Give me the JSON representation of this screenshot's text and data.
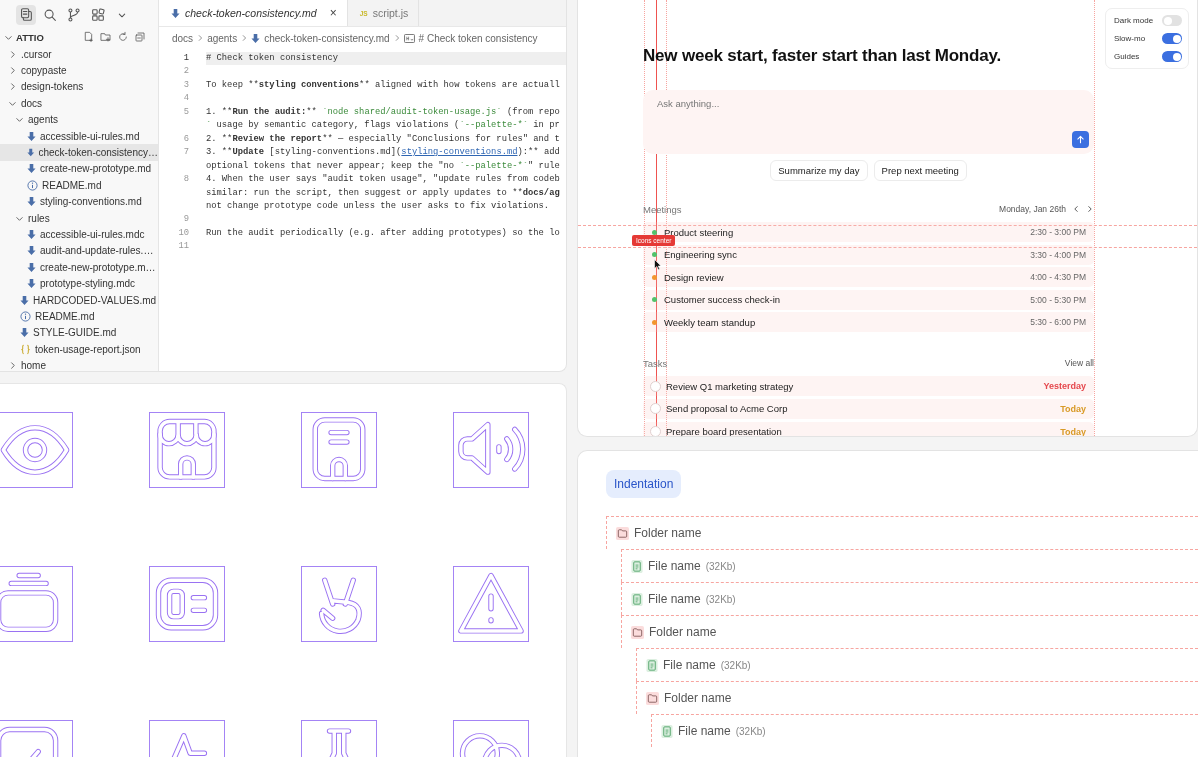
{
  "editor": {
    "activity_bar": [
      {
        "kind": "files",
        "selected": true
      },
      {
        "kind": "search",
        "selected": false
      },
      {
        "kind": "source-control",
        "selected": false
      },
      {
        "kind": "extensions",
        "selected": false
      },
      {
        "kind": "more",
        "selected": false
      }
    ],
    "explorer": {
      "title": "ATTIO",
      "expanded": true,
      "items": [
        {
          "name": ".cursor",
          "kind": "folder",
          "expanded": false,
          "selected": false
        },
        {
          "name": "copypaste",
          "kind": "folder",
          "expanded": false,
          "selected": false
        },
        {
          "name": "design-tokens",
          "kind": "folder",
          "expanded": false,
          "selected": false
        },
        {
          "name": "docs",
          "kind": "folder",
          "expanded": true,
          "selected": false,
          "children": [
            {
              "name": "agents",
              "kind": "folder",
              "expanded": true,
              "selected": false,
              "children": [
                {
                  "name": "accessible-ui-rules.md",
                  "kind": "md",
                  "selected": false
                },
                {
                  "name": "check-token-consistency…",
                  "kind": "md",
                  "selected": true
                },
                {
                  "name": "create-new-prototype.md",
                  "kind": "md",
                  "selected": false
                },
                {
                  "name": "README.md",
                  "kind": "info",
                  "selected": false
                },
                {
                  "name": "styling-conventions.md",
                  "kind": "md",
                  "selected": false
                }
              ]
            },
            {
              "name": "rules",
              "kind": "folder",
              "expanded": true,
              "selected": false,
              "children": [
                {
                  "name": "accessible-ui-rules.mdc",
                  "kind": "md",
                  "selected": false
                },
                {
                  "name": "audit-and-update-rules.…",
                  "kind": "md",
                  "selected": false
                },
                {
                  "name": "create-new-prototype.m…",
                  "kind": "md",
                  "selected": false
                },
                {
                  "name": "prototype-styling.mdc",
                  "kind": "md",
                  "selected": false
                }
              ]
            },
            {
              "name": "HARDCODED-VALUES.md",
              "kind": "md",
              "selected": false
            },
            {
              "name": "README.md",
              "kind": "info",
              "selected": false
            },
            {
              "name": "STYLE-GUIDE.md",
              "kind": "md",
              "selected": false
            },
            {
              "name": "token-usage-report.json",
              "kind": "json",
              "selected": false
            }
          ]
        },
        {
          "name": "home",
          "kind": "folder",
          "expanded": false,
          "selected": false
        }
      ]
    },
    "tabs": [
      {
        "label": "check-token-consistency.md",
        "kind": "md",
        "selected": true,
        "close": "×"
      },
      {
        "label": "script.js",
        "kind": "js",
        "badge": "JS",
        "selected": false
      }
    ],
    "breadcrumbs": [
      {
        "label": "docs"
      },
      {
        "label": "agents"
      },
      {
        "label": "check-token-consistency.md",
        "kind": "md"
      },
      {
        "label": "# Check token consistency",
        "kind": "heading"
      }
    ],
    "lines": [
      {
        "number": "1",
        "current": true,
        "rows": [
          {
            "parts": [
              {
                "kind": "plain",
                "text": "# Check token consistency"
              }
            ]
          }
        ]
      },
      {
        "number": "2",
        "current": false
      },
      {
        "number": "3",
        "current": false,
        "rows": [
          {
            "parts": [
              {
                "kind": "plain",
                "text": "To keep **"
              },
              {
                "kind": "bold",
                "text": "styling conventions"
              },
              {
                "kind": "plain",
                "text": "** aligned with how tokens are actuall"
              }
            ]
          }
        ]
      },
      {
        "number": "4",
        "current": false
      },
      {
        "number": "5",
        "current": false,
        "rows": [
          {
            "parts": [
              {
                "kind": "plain",
                "text": "1. **"
              },
              {
                "kind": "bold",
                "text": "Run the audit:"
              },
              {
                "kind": "plain",
                "text": "** "
              },
              {
                "kind": "code",
                "text": "`node shared/audit-token-usage.js`"
              },
              {
                "kind": "plain",
                "text": " (from repo"
              }
            ]
          },
          {
            "parts": [
              {
                "kind": "code",
                "text": "`"
              },
              {
                "kind": "plain",
                "text": " usage by semantic category, flags violations ("
              },
              {
                "kind": "code",
                "text": "`--palette-*`"
              },
              {
                "kind": "plain",
                "text": " in pr"
              }
            ]
          }
        ]
      },
      {
        "number": "6",
        "current": false,
        "rows": [
          {
            "parts": [
              {
                "kind": "plain",
                "text": "2. **"
              },
              {
                "kind": "bold",
                "text": "Review the report"
              },
              {
                "kind": "plain",
                "text": "** — especially \"Conclusions for rules\" and t"
              }
            ]
          }
        ]
      },
      {
        "number": "7",
        "current": false,
        "rows": [
          {
            "parts": [
              {
                "kind": "plain",
                "text": "3. **"
              },
              {
                "kind": "bold",
                "text": "Update"
              },
              {
                "kind": "plain",
                "text": " [styling-conventions.md]("
              },
              {
                "kind": "link",
                "text": "styling-conventions.md"
              },
              {
                "kind": "plain",
                "text": "):** add"
              }
            ]
          },
          {
            "parts": [
              {
                "kind": "plain",
                "text": "optional tokens that never appear; keep the \"no "
              },
              {
                "kind": "code",
                "text": "`--palette-*`"
              },
              {
                "kind": "plain",
                "text": "\" rule"
              }
            ]
          }
        ]
      },
      {
        "number": "8",
        "current": false,
        "rows": [
          {
            "parts": [
              {
                "kind": "plain",
                "text": "4. When the user says \"audit token usage\", \"update rules from codeb"
              }
            ]
          },
          {
            "parts": [
              {
                "kind": "plain",
                "text": "similar: run the script, then suggest or apply updates to **"
              },
              {
                "kind": "bold",
                "text": "docs/ag"
              }
            ]
          },
          {
            "parts": [
              {
                "kind": "plain",
                "text": "not change prototype code unless the user asks to fix violations."
              }
            ]
          }
        ]
      },
      {
        "number": "9",
        "current": false
      },
      {
        "number": "10",
        "current": false,
        "rows": [
          {
            "parts": [
              {
                "kind": "plain",
                "text": "Run the audit periodically (e.g. after adding prototypes) so the lo"
              }
            ]
          }
        ]
      },
      {
        "number": "11",
        "current": false
      }
    ]
  },
  "dashboard": {
    "heading": "New week start, faster start than last Monday.",
    "ask": {
      "placeholder": "Ask anything..."
    },
    "suggestions": [
      "Summarize my day",
      "Prep next meeting"
    ],
    "meetings": {
      "title": "Meetings",
      "date": "Monday, Jan 26th",
      "items": [
        {
          "title": "Product steering",
          "time": "2:30 - 3:00 PM",
          "color": "#52c26b"
        },
        {
          "title": "Engineering sync",
          "time": "3:30 - 4:00 PM",
          "color": "#52c26b"
        },
        {
          "title": "Design review",
          "time": "4:00 - 4:30 PM",
          "color": "#f2962f"
        },
        {
          "title": "Customer success check-in",
          "time": "5:00 - 5:30 PM",
          "color": "#52c26b"
        },
        {
          "title": "Weekly team standup",
          "time": "5:30 - 6:00 PM",
          "color": "#f2962f"
        }
      ]
    },
    "tasks": {
      "title": "Tasks",
      "link": "View all",
      "items": [
        {
          "title": "Review Q1 marketing strategy",
          "due": "Yesterday",
          "color": "#e5484d",
          "done": false
        },
        {
          "title": "Send proposal to Acme Corp",
          "due": "Today",
          "color": "#d99a26",
          "done": false
        },
        {
          "title": "Prepare board presentation",
          "due": "Today",
          "color": "#d99a26",
          "done": false
        }
      ]
    },
    "settings": [
      {
        "label": "Dark mode",
        "on": false
      },
      {
        "label": "Slow-mo",
        "on": true
      },
      {
        "label": "Guides",
        "on": true
      }
    ],
    "guides": {
      "label": "Icons center"
    }
  },
  "indentation": {
    "chip": "Indentation",
    "tree": [
      {
        "kind": "folder",
        "name": "Folder name",
        "children": [
          {
            "kind": "file",
            "name": "File name",
            "size": "(32Kb)"
          },
          {
            "kind": "file",
            "name": "File name",
            "size": "(32Kb)"
          },
          {
            "kind": "folder",
            "name": "Folder name",
            "children": [
              {
                "kind": "file",
                "name": "File name",
                "size": "(32Kb)"
              },
              {
                "kind": "folder",
                "name": "Folder name",
                "children": [
                  {
                    "kind": "file",
                    "name": "File name",
                    "size": "(32Kb)"
                  }
                ]
              }
            ]
          }
        ]
      }
    ]
  }
}
